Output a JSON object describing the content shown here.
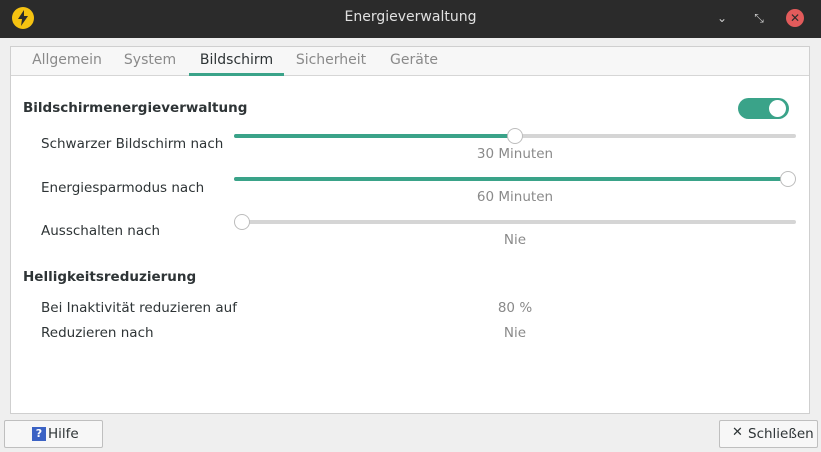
{
  "window": {
    "title": "Energieverwaltung",
    "minimize_glyph": "⌄",
    "maximize_glyph": "⤡",
    "close_glyph": "✕"
  },
  "tabs": [
    {
      "label": "Allgemein",
      "active": false
    },
    {
      "label": "System",
      "active": false
    },
    {
      "label": "Bildschirm",
      "active": true
    },
    {
      "label": "Sicherheit",
      "active": false
    },
    {
      "label": "Geräte",
      "active": false
    }
  ],
  "display_power": {
    "title": "Bildschirmenergieverwaltung",
    "enabled": true,
    "rows": [
      {
        "label": "Schwarzer Bildschirm nach",
        "value": "30 Minuten",
        "fraction": 0.5
      },
      {
        "label": "Energiesparmodus nach",
        "value": "60 Minuten",
        "fraction": 1.0
      },
      {
        "label": "Ausschalten nach",
        "value": "Nie",
        "fraction": 0.0
      }
    ]
  },
  "brightness": {
    "title": "Helligkeitsreduzierung",
    "rows": [
      {
        "label": "Bei Inaktivität reduzieren auf",
        "value": "80 %"
      },
      {
        "label": "Reduzieren nach",
        "value": "Nie"
      }
    ]
  },
  "buttons": {
    "help": "Hilfe",
    "help_glyph": "?",
    "close": "Schließen",
    "close_glyph": "✕"
  },
  "colors": {
    "accent": "#3aa389",
    "titlebar": "#2b2b2b",
    "close_button": "#e25b5b",
    "app_icon": "#f5c211"
  },
  "icons": {
    "app": "lightning-icon",
    "help": "help-icon",
    "close": "close-icon"
  }
}
